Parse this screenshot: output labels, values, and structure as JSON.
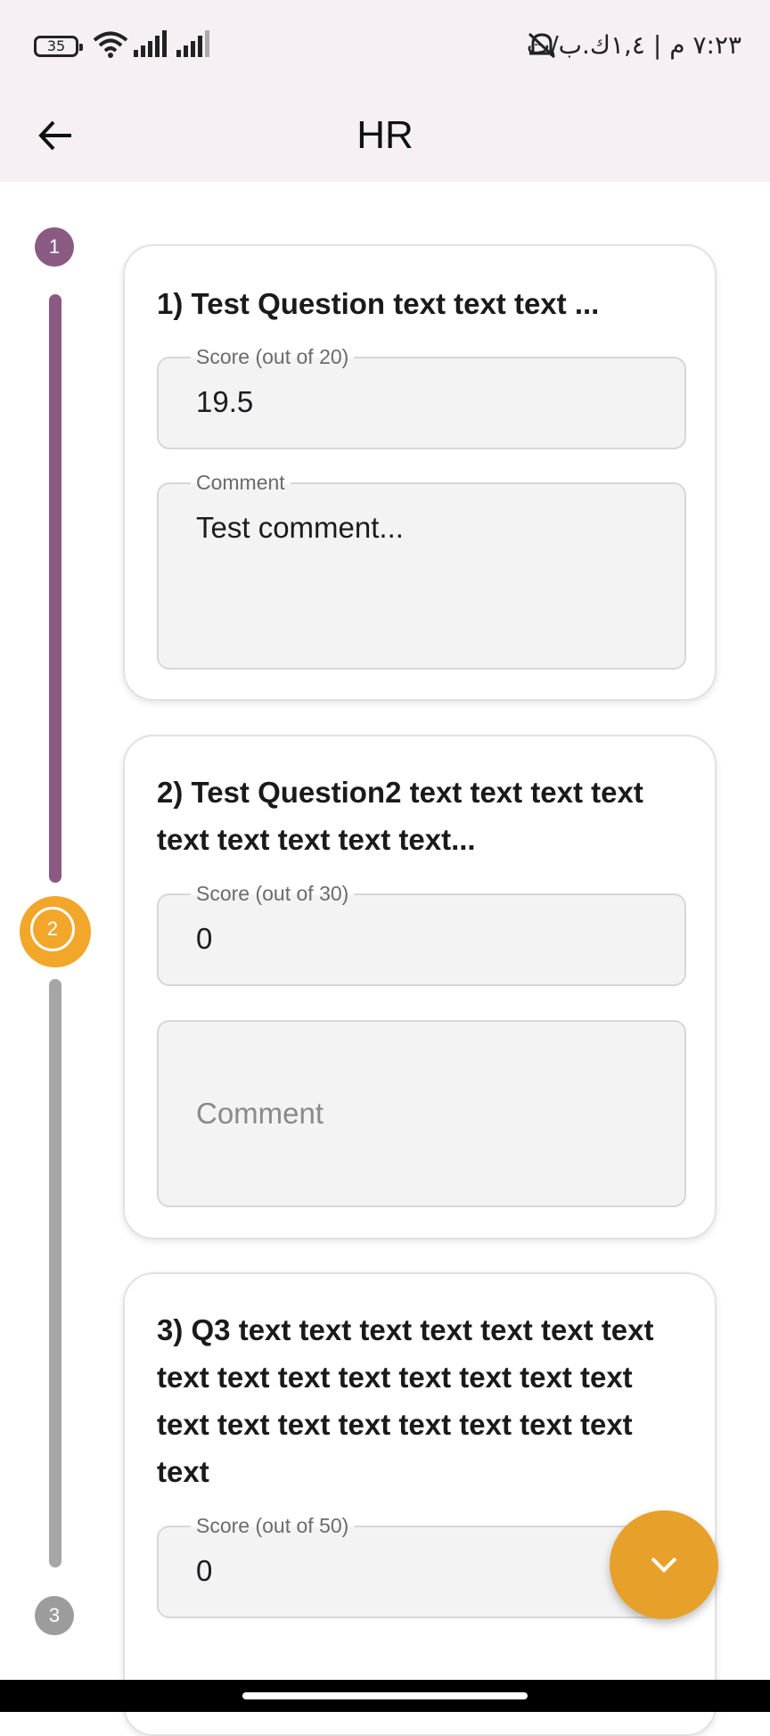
{
  "status_bar": {
    "battery": "35",
    "time": "٧:٢٣ م | ١,٤ك.ب/ث"
  },
  "app_bar": {
    "title": "HR"
  },
  "stepper": {
    "steps": [
      "1",
      "2",
      "3"
    ],
    "active_color": "#f2a62a",
    "done_color": "#8a5a82",
    "todo_color": "#9c9c9c"
  },
  "questions": [
    {
      "text": "1) Test Question text text text ...",
      "score_label": "Score (out of 20)",
      "score_value": "19.5",
      "comment_label": "Comment",
      "comment_value": "Test comment..."
    },
    {
      "text": "2) Test Question2 text text text  text text text text text text...",
      "score_label": "Score (out of 30)",
      "score_value": "0",
      "comment_placeholder": "Comment"
    },
    {
      "text": "3) Q3  text text text text text text text text text text text text text text text text text text text text text text text text",
      "score_label": "Score (out of 50)",
      "score_value": "0"
    }
  ],
  "icons": {
    "back": "arrow-left-icon",
    "fab": "chevron-down-icon",
    "wifi": "wifi-icon",
    "signal": "signal-icon",
    "mute": "bell-off-icon"
  }
}
